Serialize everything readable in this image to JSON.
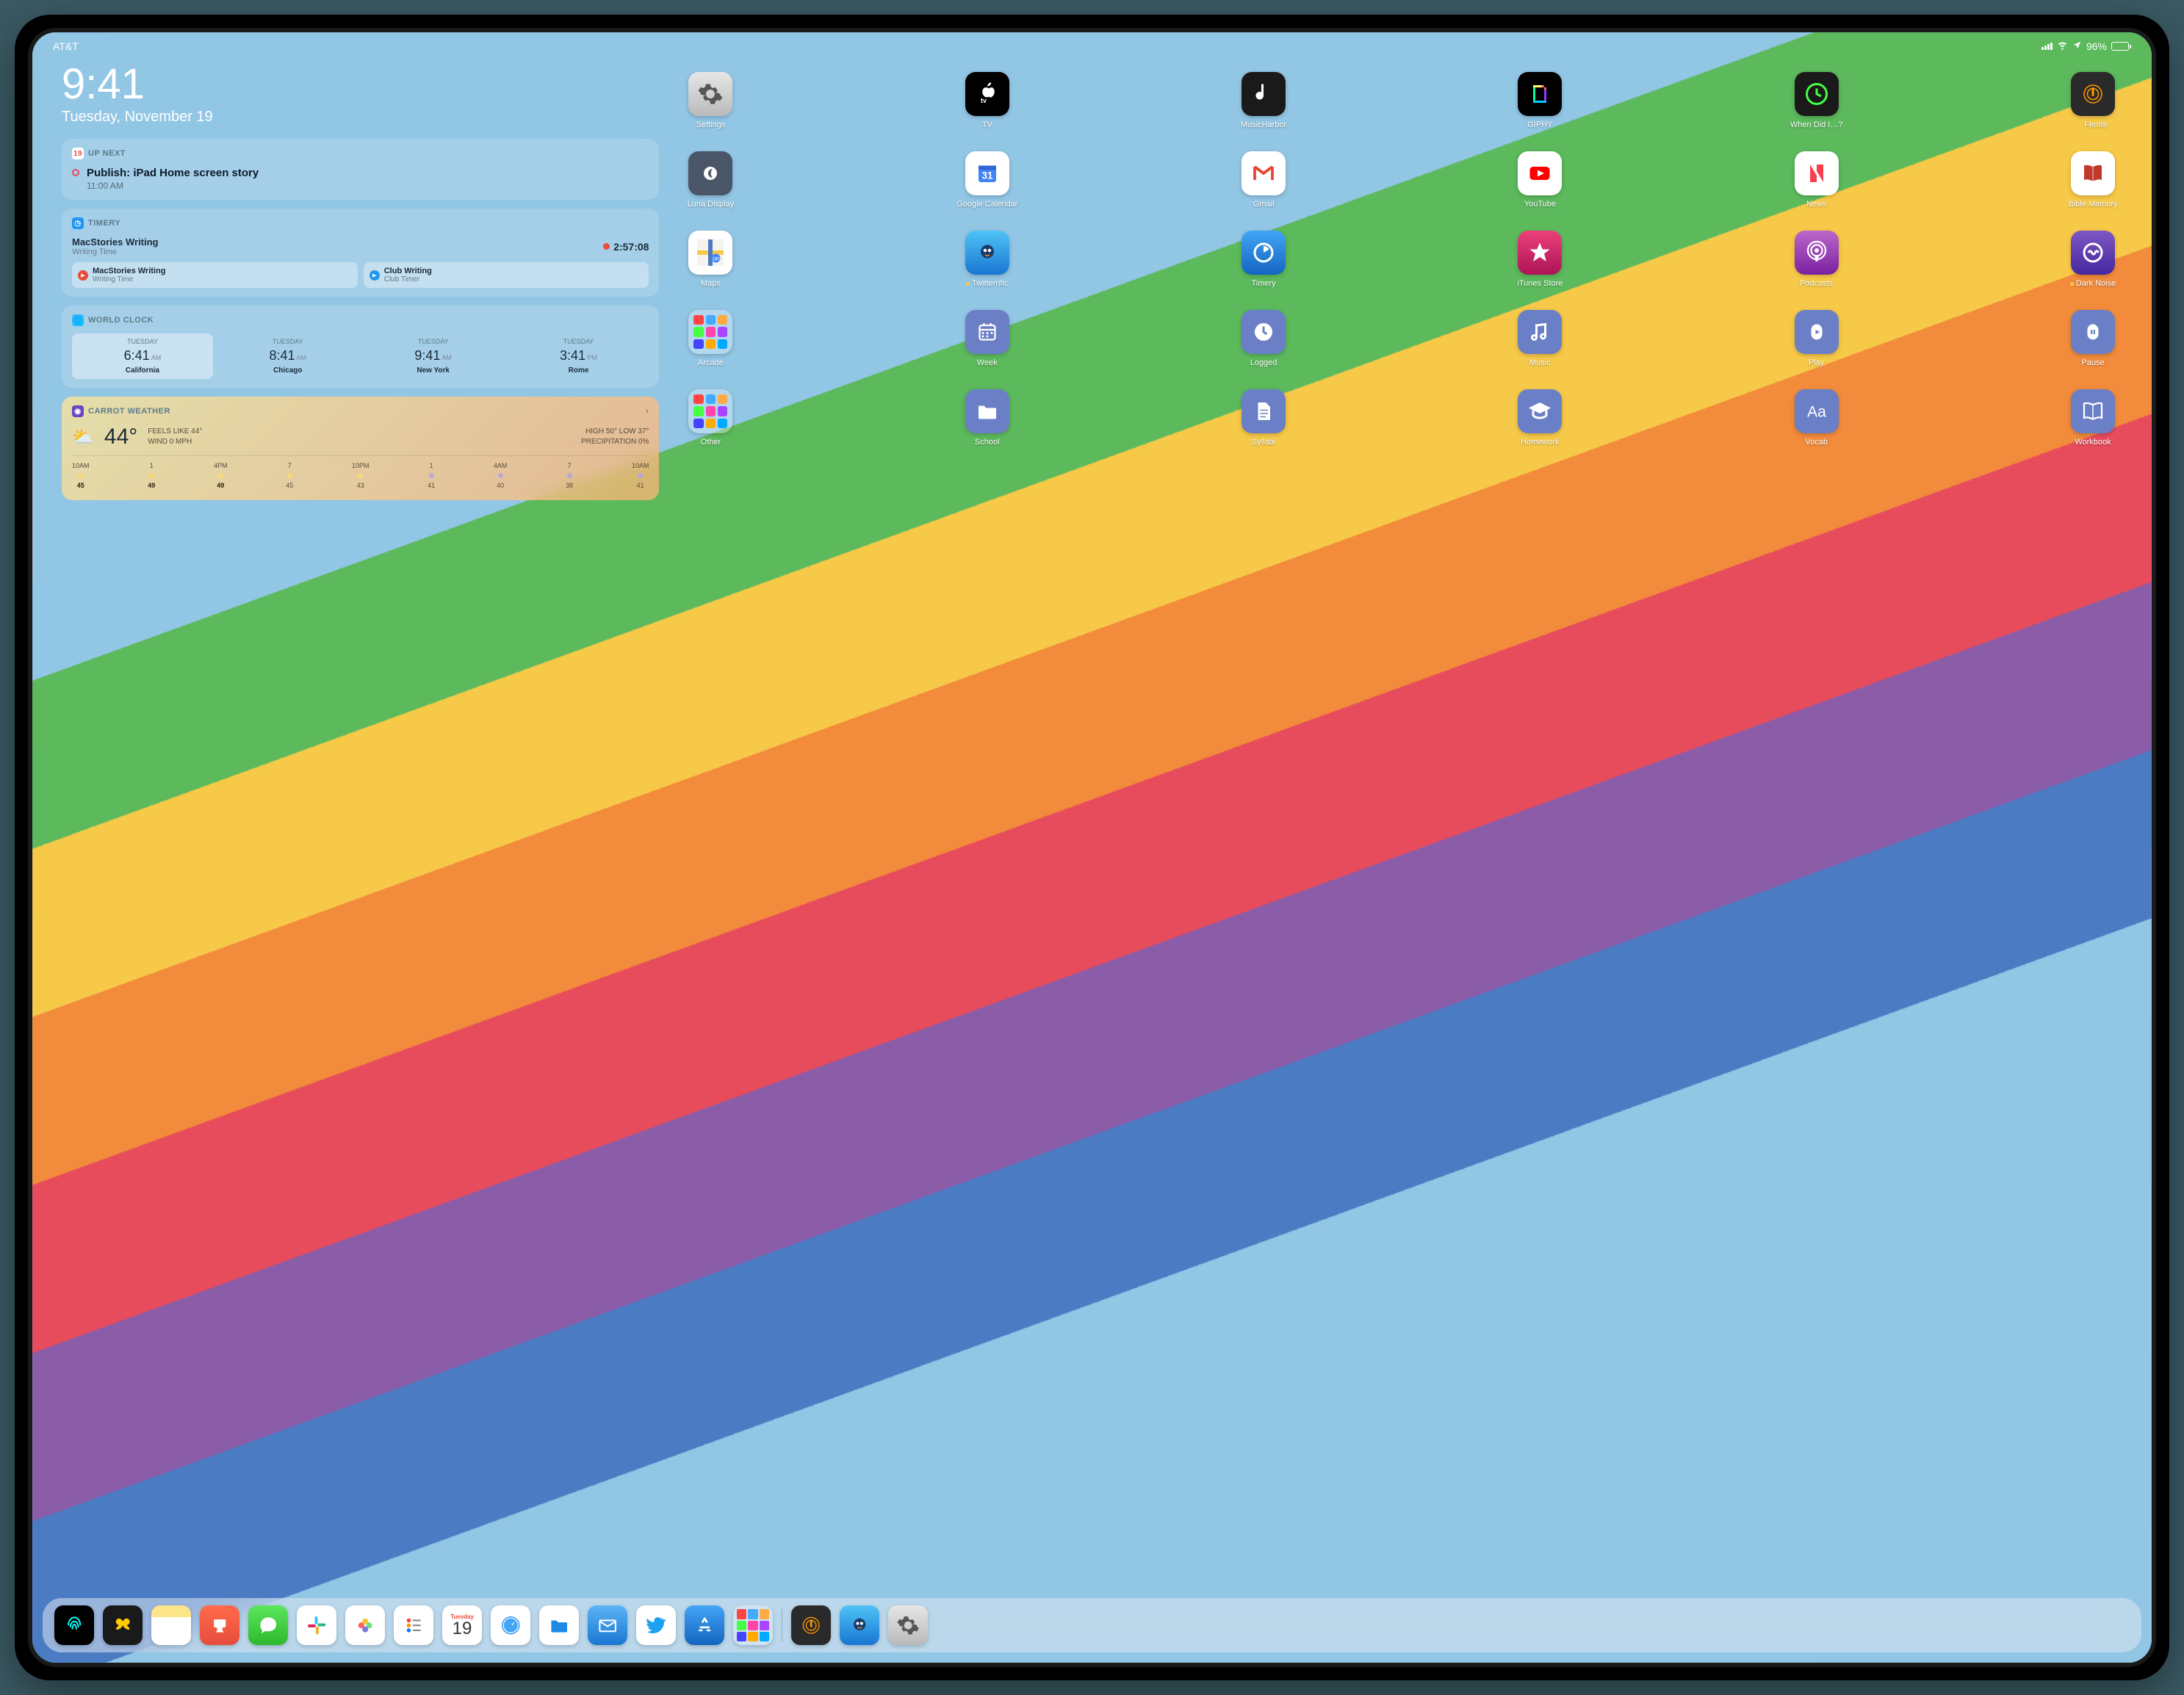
{
  "status": {
    "carrier": "AT&T",
    "battery_pct": "96%"
  },
  "clock": {
    "time": "9:41",
    "date": "Tuesday, November 19"
  },
  "upnext": {
    "header": "UP NEXT",
    "badge": "19",
    "title": "Publish: iPad Home screen story",
    "time": "11:00 AM"
  },
  "timery": {
    "header": "TIMERY",
    "current": {
      "name": "MacStories Writing",
      "sub": "Writing Time",
      "elapsed": "2:57:08"
    },
    "cards": [
      {
        "name": "MacStories Writing",
        "sub": "Writing Time",
        "color": "#e74c3c"
      },
      {
        "name": "Club Writing",
        "sub": "Club Timer",
        "color": "#2196F3"
      }
    ]
  },
  "worldclock": {
    "header": "WORLD CLOCK",
    "cells": [
      {
        "day": "TUESDAY",
        "time": "6:41",
        "ampm": "AM",
        "city": "California",
        "active": true
      },
      {
        "day": "TUESDAY",
        "time": "8:41",
        "ampm": "AM",
        "city": "Chicago"
      },
      {
        "day": "TUESDAY",
        "time": "9:41",
        "ampm": "AM",
        "city": "New York"
      },
      {
        "day": "TUESDAY",
        "time": "3:41",
        "ampm": "PM",
        "city": "Rome"
      }
    ]
  },
  "carrot": {
    "header": "CARROT WEATHER",
    "temp": "44°",
    "feels": "FEELS LIKE 44°",
    "wind": "WIND 0 MPH",
    "high": "HIGH 50° LOW 37°",
    "precip": "PRECIPITATION 0%",
    "hours": [
      {
        "h": "10AM",
        "t": "45",
        "b": true
      },
      {
        "h": "1",
        "t": "49",
        "b": true
      },
      {
        "h": "4PM",
        "t": "49",
        "b": true
      },
      {
        "h": "7",
        "t": "45"
      },
      {
        "h": "10PM",
        "t": "43"
      },
      {
        "h": "1",
        "t": "41"
      },
      {
        "h": "4AM",
        "t": "40"
      },
      {
        "h": "7",
        "t": "38"
      },
      {
        "h": "10AM",
        "t": "41"
      }
    ]
  },
  "grid": [
    [
      {
        "name": "Settings",
        "bg": "linear-gradient(#e6e6e6,#bababa)",
        "icon": "gear"
      },
      {
        "name": "TV",
        "bg": "#000",
        "icon": "atv"
      },
      {
        "name": "MusicHarbor",
        "bg": "#1a1a1a",
        "icon": "note"
      },
      {
        "name": "GIPHY",
        "bg": "#000",
        "icon": "giphy"
      },
      {
        "name": "When Did I…?",
        "bg": "#1a1a1a",
        "icon": "wdi"
      },
      {
        "name": "Ferrite",
        "bg": "#2a2a2a",
        "icon": "ferrite",
        "ind": true
      }
    ],
    [
      {
        "name": "Luna Display",
        "bg": "#4a5568",
        "icon": "luna"
      },
      {
        "name": "Google Calendar",
        "bg": "#fff",
        "icon": "gcal"
      },
      {
        "name": "Gmail",
        "bg": "#fff",
        "icon": "gmail"
      },
      {
        "name": "YouTube",
        "bg": "#fff",
        "icon": "yt"
      },
      {
        "name": "News",
        "bg": "#fff",
        "icon": "news"
      },
      {
        "name": "Bible Memory",
        "bg": "#fff",
        "icon": "bible"
      }
    ],
    [
      {
        "name": "Maps",
        "bg": "#fff",
        "icon": "maps"
      },
      {
        "name": "Tweetbot",
        "display": "Twitterrific",
        "bg": "linear-gradient(#4fc3f7,#1976d2)",
        "icon": "bird",
        "ind": true
      },
      {
        "name": "Timery",
        "bg": "linear-gradient(#42a5f5,#1565c0)",
        "icon": "timery"
      },
      {
        "name": "iTunes Store",
        "bg": "linear-gradient(#ec407a,#ad1457)",
        "icon": "star"
      },
      {
        "name": "Podcasts",
        "bg": "linear-gradient(#ba68c8,#7b1fa2)",
        "icon": "podcast"
      },
      {
        "name": "Dark Noise",
        "bg": "linear-gradient(#7e57c2,#4527a0)",
        "icon": "wave",
        "ind": true
      }
    ],
    [
      {
        "name": "Arcade",
        "folder": true,
        "colors": [
          "#f44",
          "#4af",
          "#fa4",
          "#4f4",
          "#f4a",
          "#a4f",
          "#44f",
          "#fa0",
          "#0af"
        ]
      },
      {
        "name": "Week",
        "bg": "#6b7fc7",
        "icon": "week"
      },
      {
        "name": "Logged",
        "bg": "#6b7fc7",
        "icon": "clock"
      },
      {
        "name": "Music",
        "bg": "#6b7fc7",
        "icon": "music"
      },
      {
        "name": "Play",
        "bg": "#6b7fc7",
        "icon": "play"
      },
      {
        "name": "Pause",
        "bg": "#6b7fc7",
        "icon": "pause"
      }
    ],
    [
      {
        "name": "Other",
        "folder": true,
        "colors": [
          "#f44",
          "#4af",
          "#fa4",
          "#4f4",
          "#f4a",
          "#a4f",
          "#44f",
          "#fa0",
          "#0af"
        ]
      },
      {
        "name": "School",
        "bg": "#6b7fc7",
        "icon": "folder"
      },
      {
        "name": "Syllabi",
        "bg": "#6b7fc7",
        "icon": "doc"
      },
      {
        "name": "Homework",
        "bg": "#6b7fc7",
        "icon": "grad"
      },
      {
        "name": "Vocab",
        "bg": "#6b7fc7",
        "icon": "aa"
      },
      {
        "name": "Workbook",
        "bg": "#6b7fc7",
        "icon": "book"
      }
    ]
  ],
  "dock": {
    "left": [
      {
        "name": "touchid",
        "bg": "#000",
        "icon": "finger"
      },
      {
        "name": "drafts",
        "bg": "#1a1a1a",
        "icon": "butterfly"
      },
      {
        "name": "notes",
        "bg": "linear-gradient(#fde68a 30%,#fff 30%)",
        "icon": ""
      },
      {
        "name": "keynote",
        "bg": "linear-gradient(#ff6b4a,#e74c3c)",
        "icon": "podium"
      },
      {
        "name": "messages",
        "bg": "linear-gradient(#5ce65c,#2eb82e)",
        "icon": "msg"
      },
      {
        "name": "slack",
        "bg": "#fff",
        "icon": "slack"
      },
      {
        "name": "photos",
        "bg": "#fff",
        "icon": "photos"
      },
      {
        "name": "reminders",
        "bg": "#fff",
        "icon": "rem"
      },
      {
        "name": "calendar",
        "bg": "#fff",
        "icon": "cal",
        "day": "Tuesday",
        "num": "19"
      },
      {
        "name": "safari",
        "bg": "#fff",
        "icon": "safari"
      },
      {
        "name": "files",
        "bg": "#fff",
        "icon": "files"
      },
      {
        "name": "mail",
        "bg": "linear-gradient(#5bb5f5,#1976d2)",
        "icon": "mail"
      },
      {
        "name": "twitter",
        "bg": "#fff",
        "icon": "tw"
      },
      {
        "name": "appstore",
        "bg": "linear-gradient(#42a5f5,#1565c0)",
        "icon": "as"
      },
      {
        "name": "shortcuts",
        "bg": "#fff",
        "icon": "sc",
        "folder": true
      }
    ],
    "right": [
      {
        "name": "ferrite",
        "bg": "#2a2a2a",
        "icon": "ferrite"
      },
      {
        "name": "twitterrific",
        "bg": "linear-gradient(#4fc3f7,#1976d2)",
        "icon": "bird"
      },
      {
        "name": "settings",
        "bg": "linear-gradient(#e6e6e6,#bababa)",
        "icon": "gear"
      }
    ]
  }
}
